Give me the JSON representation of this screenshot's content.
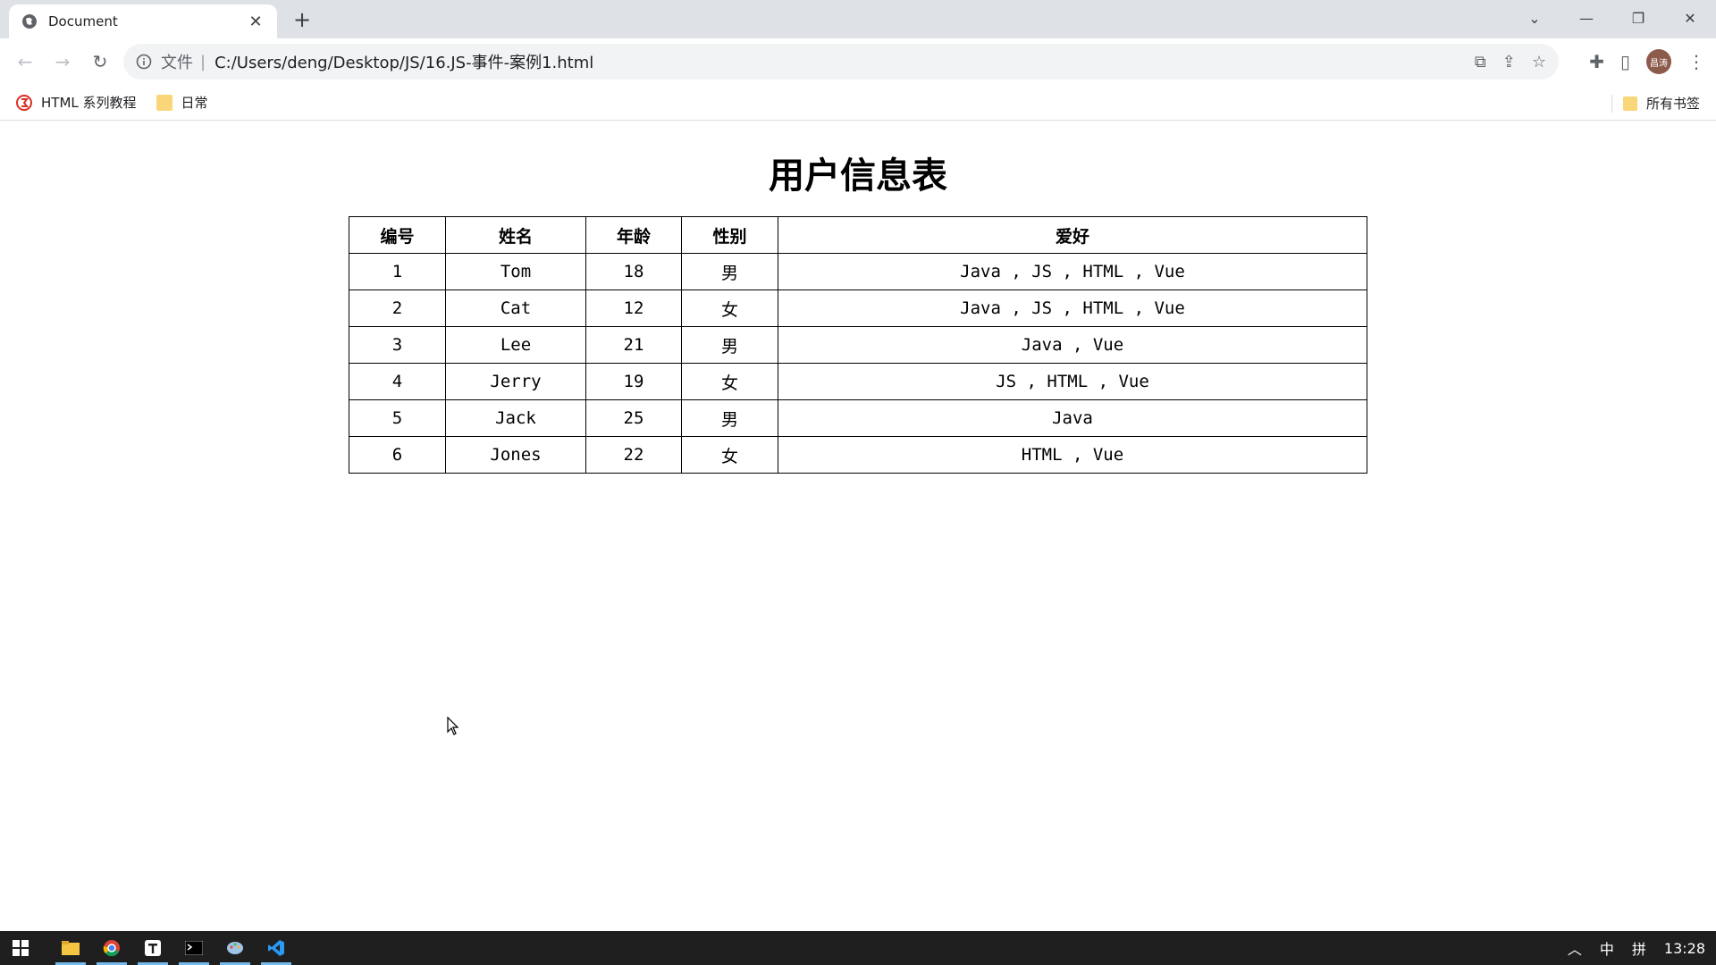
{
  "browser": {
    "tab_title": "Document",
    "new_tab_symbol": "+",
    "url_scheme": "文件",
    "url": "C:/Users/deng/Desktop/JS/16.JS-事件-案例1.html",
    "avatar_text": "昌涛",
    "bookmarks": [
      {
        "label": "HTML 系列教程",
        "icon": "html-logo-icon"
      },
      {
        "label": "日常",
        "icon": "folder-icon"
      }
    ],
    "all_bookmarks_label": "所有书签"
  },
  "page": {
    "heading": "用户信息表",
    "table": {
      "headers": [
        "编号",
        "姓名",
        "年龄",
        "性别",
        "爱好"
      ],
      "rows": [
        [
          "1",
          "Tom",
          "18",
          "男",
          "Java , JS , HTML , Vue"
        ],
        [
          "2",
          "Cat",
          "12",
          "女",
          "Java , JS , HTML , Vue"
        ],
        [
          "3",
          "Lee",
          "21",
          "男",
          "Java , Vue"
        ],
        [
          "4",
          "Jerry",
          "19",
          "女",
          "JS , HTML , Vue"
        ],
        [
          "5",
          "Jack",
          "25",
          "男",
          "Java"
        ],
        [
          "6",
          "Jones",
          "22",
          "女",
          "HTML , Vue"
        ]
      ]
    }
  },
  "taskbar": {
    "ime_lang": "中",
    "ime_mode": "拼",
    "clock": "13:28"
  }
}
